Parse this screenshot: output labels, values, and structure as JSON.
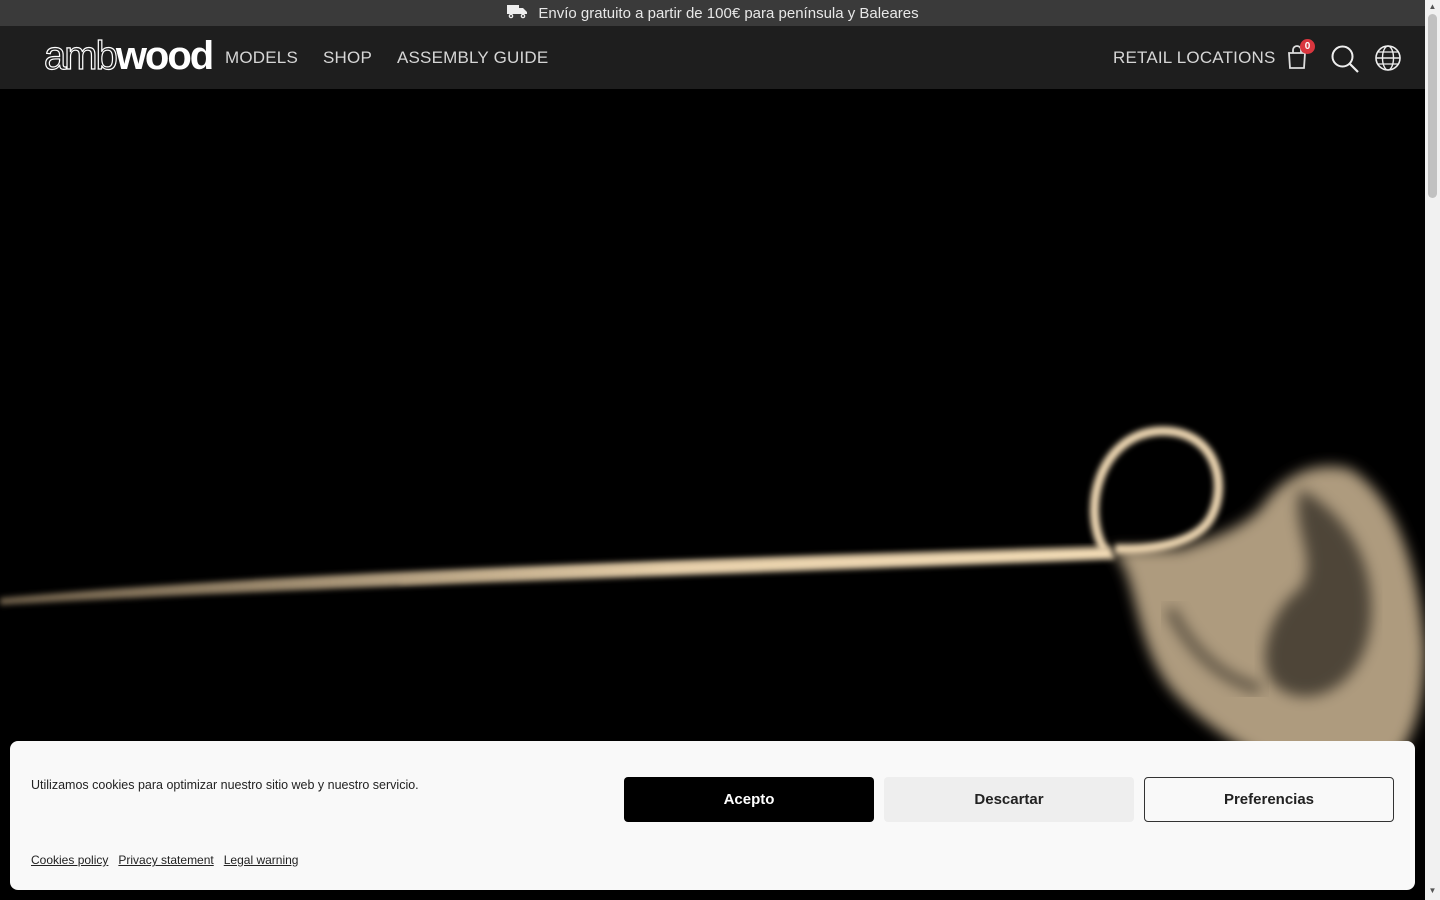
{
  "topbar": {
    "shipping_text": "Envío gratuito a partir de 100€ para península y Baleares",
    "icon": "truck-icon"
  },
  "header": {
    "logo_light": "amb",
    "logo_bold": "wood",
    "nav": [
      {
        "label": "MODELS"
      },
      {
        "label": "SHOP"
      },
      {
        "label": "ASSEMBLY GUIDE"
      }
    ],
    "retail_label": "RETAIL LOCATIONS",
    "cart_count": "0",
    "icons": [
      "cart-icon",
      "search-icon",
      "globe-icon"
    ]
  },
  "cookie_banner": {
    "message": "Utilizamos cookies para optimizar nuestro sitio web y nuestro servicio.",
    "accept_label": "Acepto",
    "dismiss_label": "Descartar",
    "preferences_label": "Preferencias",
    "links": [
      {
        "label": "Cookies policy"
      },
      {
        "label": "Privacy statement"
      },
      {
        "label": "Legal warning"
      }
    ]
  },
  "colors": {
    "topbar": "#3a3a3a",
    "header": "#1e1e1e",
    "badge": "#d9363e",
    "smoke": "#e8cfa8"
  }
}
